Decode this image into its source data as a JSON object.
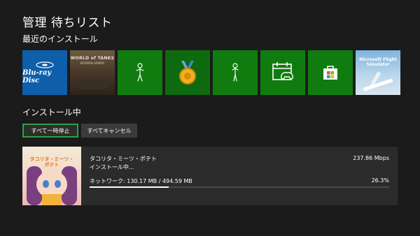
{
  "header": {
    "title": "管理  待ちリスト"
  },
  "recent": {
    "title": "最近のインストール",
    "tiles": [
      {
        "name": "bluray",
        "label": "Blu-ray Disc",
        "icon": "bluray-logo"
      },
      {
        "name": "world-of-tanks",
        "label": "WORLD of TANKS",
        "sublabel": "MODERN ARMOR"
      },
      {
        "name": "avatar-app",
        "icon": "avatar-figure-icon"
      },
      {
        "name": "achievements-app",
        "icon": "medal-icon"
      },
      {
        "name": "avatar-app-2",
        "icon": "avatar-figure-icon"
      },
      {
        "name": "calendar-app",
        "icon": "controller-calendar-icon"
      },
      {
        "name": "store-app",
        "icon": "store-bag-icon"
      },
      {
        "name": "flight-simulator",
        "label": "Microsoft Flight Simulator"
      }
    ]
  },
  "installing": {
    "title": "インストール中",
    "pause_all": "すべて一時停止",
    "cancel_all": "すべてキャンセル",
    "item": {
      "art_title": "タコリタ・ミーツ・ポテト",
      "name": "タコリタ・ミーツ・ポテト",
      "status": "インストール中...",
      "speed": "237.86 Mbps",
      "network": "ネットワーク: 130.17 MB / 494.59 MB",
      "percent": "26.3%",
      "progress_fraction": 0.263
    }
  },
  "colors": {
    "background": "#1b1b1b",
    "xbox_green": "#107c10",
    "focus_green": "#2ea043",
    "card": "#2b2b2b"
  }
}
